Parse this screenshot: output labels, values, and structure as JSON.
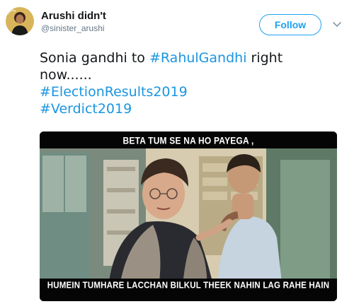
{
  "user": {
    "display_name": "Arushi didn't",
    "handle": "@sinister_arushi"
  },
  "follow_label": "Follow",
  "tweet": {
    "prefix": "Sonia gandhi to ",
    "mention_tag": "#RahulGandhi",
    "suffix": "  right",
    "line2": "now......",
    "tags": [
      "#ElectionResults2019",
      "#Verdict2019"
    ]
  },
  "meme": {
    "top_caption": "BETA TUM SE NA HO PAYEGA ,",
    "bottom_caption": "HUMEIN TUMHARE LACCHAN BILKUL THEEK NAHIN LAG RAHE HAIN"
  },
  "colors": {
    "link": "#1b95e0",
    "follow": "#1da1f2",
    "text": "#14171a",
    "muted": "#657786"
  },
  "icons": {
    "chevron": "chevron-down-icon"
  }
}
